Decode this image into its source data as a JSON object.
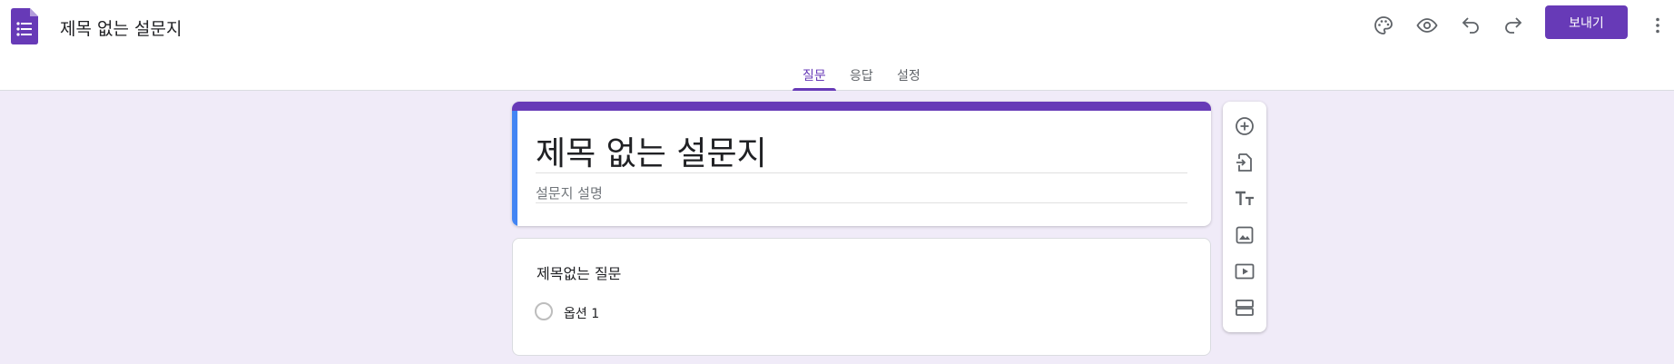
{
  "header": {
    "title": "제목 없는 설문지",
    "send_label": "보내기",
    "icons": [
      "forms-logo-icon",
      "palette-icon",
      "eye-icon",
      "undo-icon",
      "redo-icon",
      "more-vert-icon"
    ]
  },
  "tabs": [
    {
      "label": "질문",
      "active": true
    },
    {
      "label": "응답",
      "active": false
    },
    {
      "label": "설정",
      "active": false
    }
  ],
  "form": {
    "title": "제목 없는 설문지",
    "description_placeholder": "설문지 설명"
  },
  "question": {
    "title": "제목없는 질문",
    "options": [
      "옵션 1"
    ]
  },
  "side_toolbar": {
    "icons": [
      "add-question-icon",
      "import-questions-icon",
      "add-title-icon",
      "add-image-icon",
      "add-video-icon",
      "add-section-icon"
    ]
  },
  "colors": {
    "accent": "#673ab7",
    "background": "#f0ebf8",
    "title_left_bar": "#4285f4"
  }
}
